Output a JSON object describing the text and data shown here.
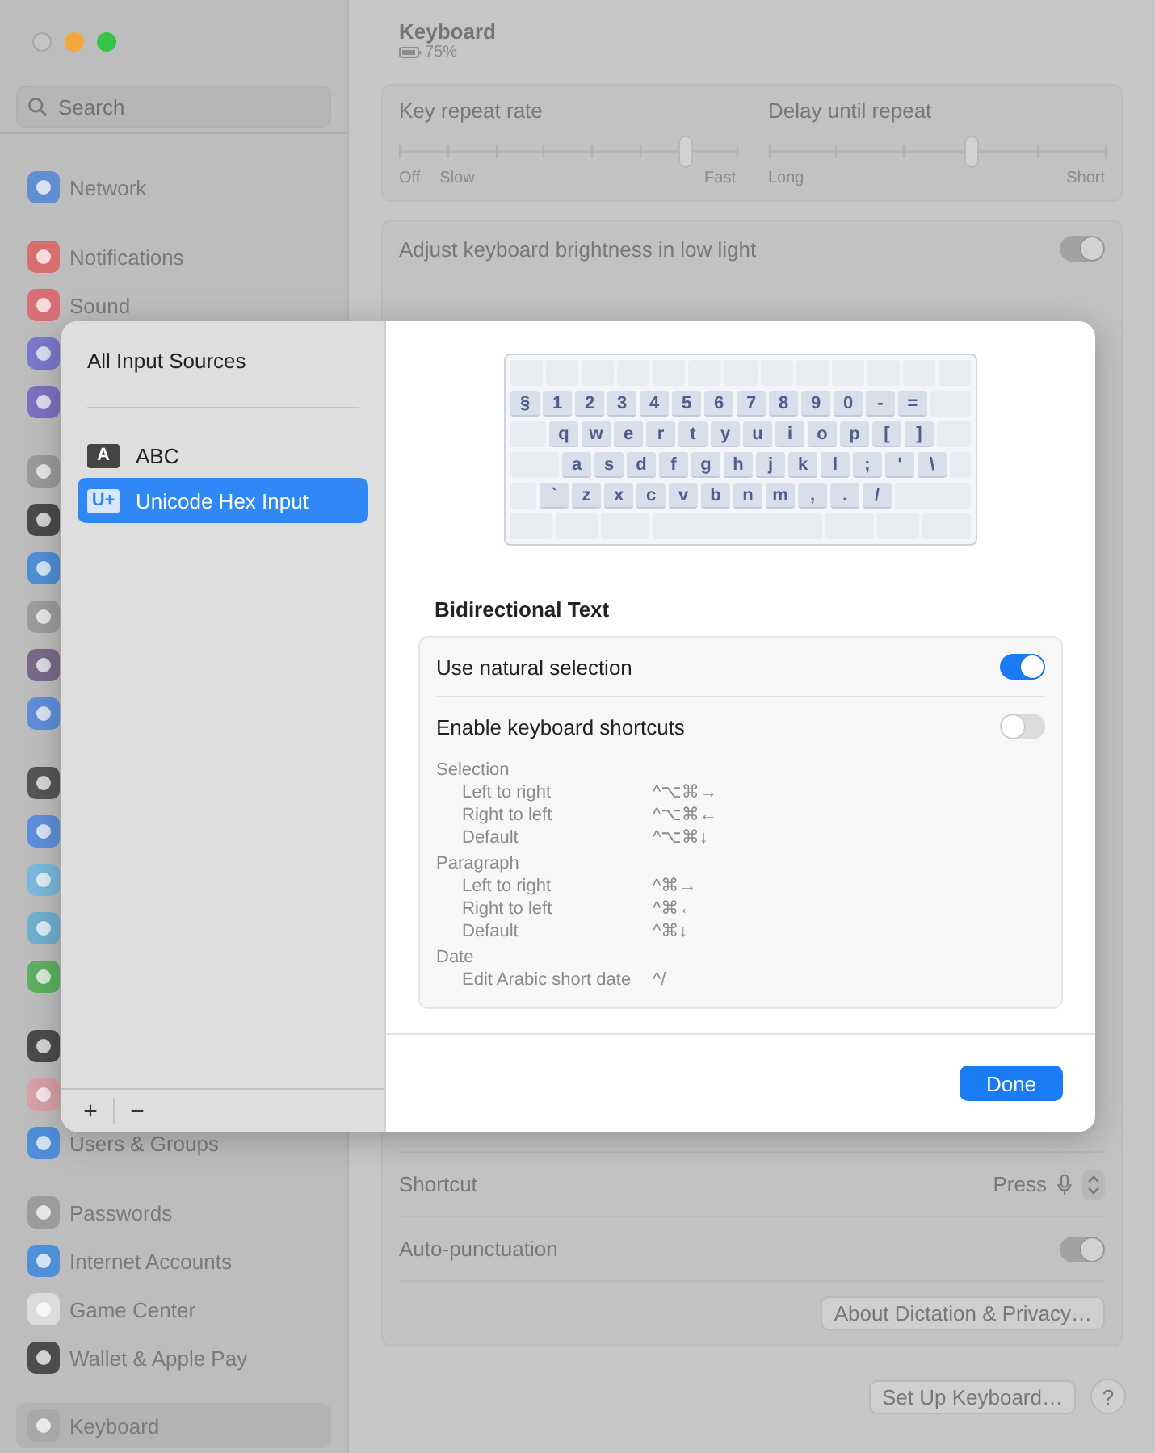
{
  "sidebar": {
    "search": {
      "placeholder": "Search"
    },
    "groups": [
      {
        "items": [
          {
            "label": "Network",
            "color": "#5f8fd0",
            "selected": false
          }
        ]
      },
      {
        "items": [
          {
            "label": "Notifications",
            "color": "#d86f6f",
            "selected": false
          },
          {
            "label": "Sound",
            "color": "#d86f78",
            "selected": false
          },
          {
            "color": "#7a78c8",
            "selected": false
          },
          {
            "color": "#7f70c0",
            "selected": false
          }
        ]
      },
      {
        "items": [
          {
            "color": "#9a9a9a",
            "selected": false
          },
          {
            "color": "#4a4a4a",
            "selected": false
          },
          {
            "color": "#4f8fd8",
            "selected": false
          },
          {
            "color": "#9c9c9c",
            "selected": false
          },
          {
            "color": "#7a6a8a",
            "selected": false
          },
          {
            "color": "#5f8fd8",
            "selected": false
          }
        ]
      },
      {
        "items": [
          {
            "color": "#555555",
            "selected": false
          },
          {
            "color": "#5f8fd9",
            "selected": false
          },
          {
            "color": "#7ab8dc",
            "selected": false
          },
          {
            "color": "#6fb0d0",
            "selected": false
          },
          {
            "color": "#5cb060",
            "selected": false
          }
        ]
      },
      {
        "items": [
          {
            "color": "#4b4b4b",
            "selected": false
          },
          {
            "color": "#d8a0a8",
            "selected": false
          },
          {
            "label": "Users & Groups",
            "color": "#4f8fd9",
            "selected": false
          }
        ]
      },
      {
        "items": [
          {
            "label": "Passwords",
            "color": "#9b9b9b",
            "selected": false
          },
          {
            "label": "Internet Accounts",
            "color": "#4e8fd8",
            "selected": false
          },
          {
            "label": "Game Center",
            "color": "#dcdcdc",
            "selected": false
          },
          {
            "label": "Wallet & Apple Pay",
            "color": "#4c4c4c",
            "selected": false
          }
        ]
      },
      {
        "items": [
          {
            "label": "Keyboard",
            "color": "#a8a8a8",
            "selected": true
          }
        ]
      }
    ]
  },
  "header": {
    "title": "Keyboard",
    "battery": "75%"
  },
  "repeat": [
    {
      "label": "Key repeat rate",
      "level": 0.85,
      "left": [
        "Off",
        "Slow"
      ],
      "right": "Fast"
    },
    {
      "label": "Delay until repeat",
      "level": 0.6,
      "left": [
        "Long"
      ],
      "right": "Short"
    }
  ],
  "brightness_row": {
    "label": "Adjust keyboard brightness in low light",
    "on": true
  },
  "dictation": {
    "shortcut": {
      "label": "Shortcut",
      "value": "Press"
    },
    "auto_punctuation": {
      "label": "Auto-punctuation",
      "on": true
    },
    "about": "About Dictation & Privacy…"
  },
  "footer": {
    "setup": "Set Up Keyboard…",
    "help": "?"
  },
  "sheet": {
    "sources_header": "All Input Sources",
    "sources": [
      {
        "badge": "A",
        "label": "ABC",
        "selected": false
      },
      {
        "badge": "U+",
        "label": "Unicode Hex Input",
        "selected": true
      }
    ],
    "list_buttons": [
      "+",
      "−"
    ],
    "key_rows": [
      [
        "§",
        "1",
        "2",
        "3",
        "4",
        "5",
        "6",
        "7",
        "8",
        "9",
        "0",
        "-",
        "="
      ],
      [
        "q",
        "w",
        "e",
        "r",
        "t",
        "y",
        "u",
        "i",
        "o",
        "p",
        "[",
        "]"
      ],
      [
        "a",
        "s",
        "d",
        "f",
        "g",
        "h",
        "j",
        "k",
        "l",
        ";",
        "'",
        "\\"
      ],
      [
        "`",
        "z",
        "x",
        "c",
        "v",
        "b",
        "n",
        "m",
        ",",
        ".",
        "/"
      ]
    ],
    "section_title": "Bidirectional Text",
    "settings": [
      {
        "label": "Use natural selection",
        "on": true
      },
      {
        "label": "Enable keyboard shortcuts",
        "on": false
      }
    ],
    "shortcut_groups": [
      {
        "title": "Selection",
        "items": [
          {
            "label": "Left to right",
            "keys": "^⌥⌘→"
          },
          {
            "label": "Right to left",
            "keys": "^⌥⌘←"
          },
          {
            "label": "Default",
            "keys": "^⌥⌘↓"
          }
        ]
      },
      {
        "title": "Paragraph",
        "items": [
          {
            "label": "Left to right",
            "keys": "^⌘→"
          },
          {
            "label": "Right to left",
            "keys": "^⌘←"
          },
          {
            "label": "Default",
            "keys": "^⌘↓"
          }
        ]
      },
      {
        "title": "Date",
        "items": [
          {
            "label": "Edit Arabic short date",
            "keys": "^/"
          }
        ]
      }
    ],
    "done": "Done"
  }
}
